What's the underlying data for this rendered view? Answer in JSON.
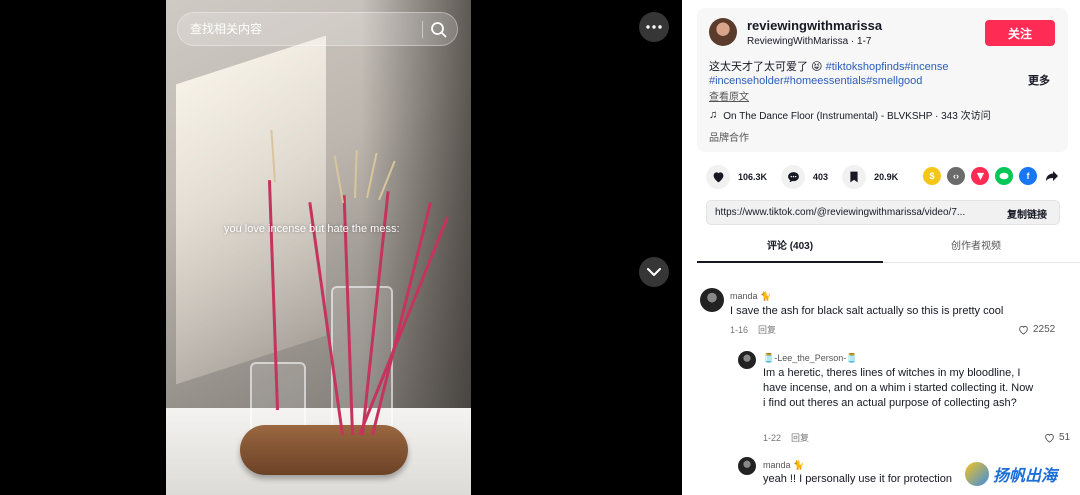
{
  "search": {
    "placeholder": "查找相关内容"
  },
  "video": {
    "overlay_text": "you love incense but hate the mess:"
  },
  "author": {
    "username": "reviewingwithmarissa",
    "nickname": "ReviewingWithMarissa",
    "date": "1-7",
    "follow_label": "关注"
  },
  "caption": {
    "text": "这太天才了太可爱了 😝 ",
    "hashtags_line1": "#tiktokshopfinds#incense",
    "hashtags_line2": "#incenseholder#homeessentials#smellgood",
    "see_more": "更多",
    "translate": "查看原文",
    "music": "On The Dance Floor (Instrumental) - BLVKSHP · 343 次访问",
    "brand": "品牌合作"
  },
  "stats": {
    "likes": "106.3K",
    "comments": "403",
    "saves": "20.9K"
  },
  "share_icons": [
    {
      "name": "coin-icon",
      "color": "#f5c518"
    },
    {
      "name": "embed-icon",
      "color": "#6b6b6b"
    },
    {
      "name": "send-icon",
      "color": "#fe2c55"
    },
    {
      "name": "line-icon",
      "color": "#06c755"
    },
    {
      "name": "facebook-icon",
      "color": "#1877f2"
    },
    {
      "name": "forward-icon",
      "color": "#161823"
    }
  ],
  "link": {
    "url": "https://www.tiktok.com/@reviewingwithmarissa/video/7...",
    "copy_label": "复制链接"
  },
  "tabs": [
    {
      "label": "评论 (403)"
    },
    {
      "label": "创作者视频"
    }
  ],
  "comments": [
    {
      "name": "manda 🐈",
      "text": "I save the ash for black salt actually so this is pretty cool",
      "date": "1-16",
      "reply": "回复",
      "likes": "2252"
    },
    {
      "name": "🫙-Lee_the_Person-🫙",
      "text": "Im a heretic, theres lines of witches in my bloodline, I have incense, and on a whim i started collecting it. Now i find out theres an actual purpose of collecting ash?",
      "date": "1-22",
      "reply": "回复",
      "likes": "51"
    },
    {
      "name": "manda 🐈",
      "text": "yeah !! I personally use it for protection"
    }
  ],
  "watermark": {
    "text": "扬帆出海"
  }
}
